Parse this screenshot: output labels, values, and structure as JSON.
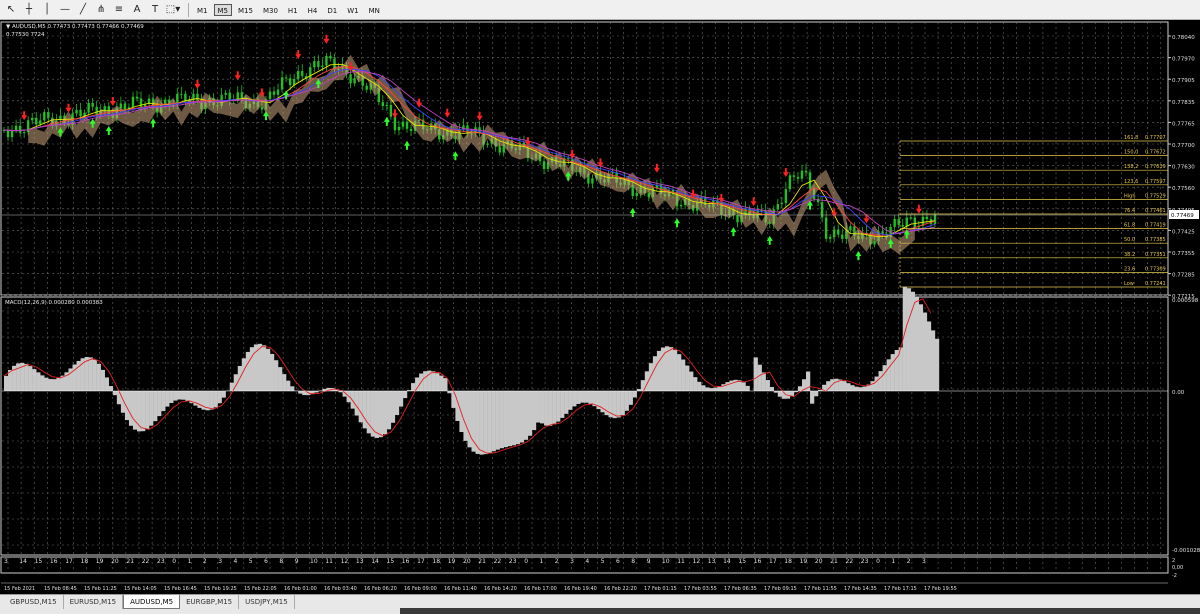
{
  "toolbar": {
    "icons": [
      "cursor-icon",
      "crosshair-icon",
      "vertical-line-icon",
      "horizontal-line-icon",
      "trendline-icon",
      "pitchfork-icon",
      "fibo-icon",
      "text-icon",
      "label-icon",
      "shapes-icon"
    ],
    "icon_glyphs": [
      "↖",
      "┼",
      "│",
      "—",
      "╱",
      "⋔",
      "≡",
      "A",
      "T",
      "⬚▾"
    ],
    "timeframes": [
      "M1",
      "M5",
      "M15",
      "M30",
      "H1",
      "H4",
      "D1",
      "W1",
      "MN"
    ],
    "active_timeframe": "M5"
  },
  "chart": {
    "header": "AUDUSD,M5  0.77473 0.77473 0.77466 0.77469",
    "subheader": "0.77530 7724",
    "price_axis": [
      "0.78040",
      "0.77970",
      "0.77905",
      "0.77835",
      "0.77765",
      "0.77700",
      "0.77630",
      "0.77560",
      "0.77495",
      "0.77425",
      "0.77355",
      "0.77285",
      "0.77215"
    ],
    "current_price": "0.77469",
    "fibo_levels": [
      {
        "pct": "161.8",
        "price": "0.77707"
      },
      {
        "pct": "150.0",
        "price": "0.77672"
      },
      {
        "pct": "138.2",
        "price": "0.77639"
      },
      {
        "pct": "123.6",
        "price": "0.77597"
      },
      {
        "pct": "High",
        "price": "0.77529"
      },
      {
        "pct": "76.4",
        "price": "0.77461"
      },
      {
        "pct": "61.8",
        "price": "0.77419"
      },
      {
        "pct": "50.0",
        "price": "0.77385"
      },
      {
        "pct": "38.2",
        "price": "0.77351"
      },
      {
        "pct": "23.6",
        "price": "0.77309"
      },
      {
        "pct": "Low",
        "price": "0.77241"
      }
    ],
    "macd_header": "MACD(12,26,9) 0.000280 0.000383",
    "macd_axis": [
      "0.000598",
      "0.00",
      "-0.001028"
    ],
    "hours": [
      "3",
      "14",
      "15",
      "16",
      "17",
      "18",
      "19",
      "20",
      "21",
      "22",
      "23",
      "0",
      "1",
      "2",
      "3",
      "4",
      "5",
      "6",
      "8",
      "9",
      "10",
      "11",
      "12",
      "13",
      "14",
      "15",
      "16",
      "17",
      "18",
      "19",
      "20",
      "21",
      "22",
      "23",
      "0",
      "1",
      "2",
      "3",
      "4",
      "5",
      "6",
      "8",
      "9",
      "10",
      "11",
      "12",
      "13",
      "14",
      "15",
      "16",
      "17",
      "18",
      "19",
      "20",
      "21",
      "22",
      "23",
      "0",
      "1",
      "2",
      "3"
    ],
    "sub_axis": [
      "2",
      "0,00",
      "-2"
    ],
    "dates": [
      "15 Feb 2021",
      "15 Feb 08:45",
      "15 Feb 11:25",
      "15 Feb 14:05",
      "15 Feb 16:45",
      "15 Feb 19:25",
      "15 Feb 22:05",
      "16 Feb 01:00",
      "16 Feb 03:40",
      "16 Feb 06:20",
      "16 Feb 09:00",
      "16 Feb 11:40",
      "16 Feb 14:20",
      "16 Feb 17:00",
      "16 Feb 19:40",
      "16 Feb 22:20",
      "17 Feb 01:15",
      "17 Feb 03:55",
      "17 Feb 06:35",
      "17 Feb 09:15",
      "17 Feb 11:55",
      "17 Feb 14:35",
      "17 Feb 17:15",
      "17 Feb 19:55"
    ]
  },
  "tabs": [
    "GBPUSD,M15",
    "EURUSD,M15",
    "AUDUSD,M5",
    "EURGBP,M15",
    "USDJPY,M15"
  ],
  "active_tab": "AUDUSD,M5",
  "colors": {
    "background": "#000000",
    "bull_candle": "#22c022",
    "bear_candle": "#22c022",
    "cloud": "#c8a27c",
    "macd_hist": "#c8c8c8",
    "macd_signal": "#e02020",
    "fibo": "#e6c84a",
    "up_arrow": "#2aff2a",
    "down_arrow": "#ff2020"
  }
}
